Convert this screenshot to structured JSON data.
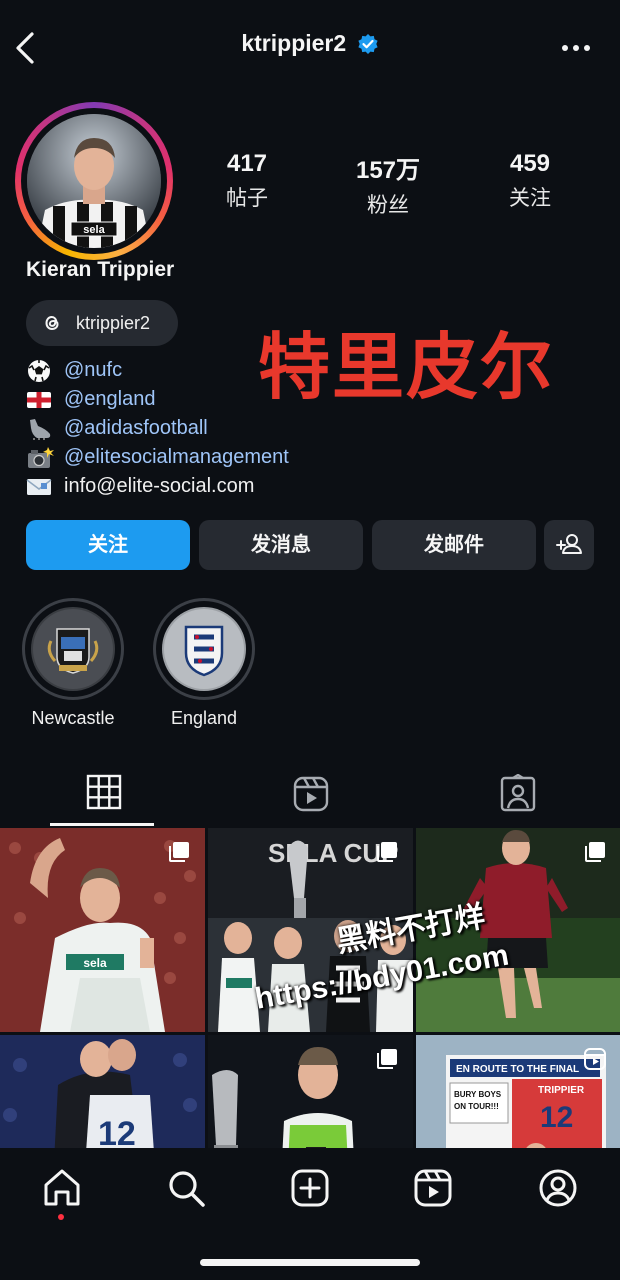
{
  "header": {
    "handle": "ktrippier2"
  },
  "profile": {
    "full_name": "Kieran Trippier",
    "stats": [
      {
        "value": "417",
        "label": "帖子"
      },
      {
        "value": "157万",
        "label": "粉丝"
      },
      {
        "value": "459",
        "label": "关注"
      }
    ],
    "threads_handle": "ktrippier2",
    "overlay_title": "特里皮尔",
    "bio": [
      {
        "icon": "soccer-ball-icon",
        "text": "@nufc",
        "is_link": true
      },
      {
        "icon": "england-flag-icon",
        "text": "@england",
        "is_link": true
      },
      {
        "icon": "football-boot-icon",
        "text": "@adidasfootball",
        "is_link": true
      },
      {
        "icon": "camera-flash-icon",
        "text": "@elitesocialmanagement",
        "is_link": true
      },
      {
        "icon": "envelope-icon",
        "text": "info@elite-social.com",
        "is_link": false
      }
    ]
  },
  "actions": {
    "follow": "关注",
    "message": "发消息",
    "email": "发邮件"
  },
  "highlights": [
    {
      "label": "Newcastle",
      "icon": "newcastle-crest-icon"
    },
    {
      "label": "England",
      "icon": "england-crest-icon"
    }
  ],
  "grid": {
    "posts": [
      {
        "kind": "carousel",
        "scene": "player waving in white kit"
      },
      {
        "kind": "carousel",
        "scene": "team trophy celebration",
        "banner": "SELA CUP"
      },
      {
        "kind": "carousel",
        "scene": "player running in red training kit"
      },
      {
        "kind": "image",
        "scene": "players embracing",
        "shirt_number": "12"
      },
      {
        "kind": "carousel",
        "scene": "player beside trophy"
      },
      {
        "kind": "reel",
        "scene": "bus banner",
        "banner": "EN ROUTE TO THE FINAL",
        "sign_left": "BURY BOYS ON TOUR!!!",
        "sign_name": "TRIPPIER",
        "sign_number": "12"
      }
    ]
  },
  "watermark": {
    "line1": "黑料不打烊",
    "line2": "https://bdy01.com"
  },
  "colors": {
    "background": "#0c0f14",
    "follow_button": "#1d9bf0",
    "secondary_button": "#262a31",
    "link": "#9fc5f8",
    "overlay": "#e8382c",
    "verified": "#1d9bf0"
  }
}
